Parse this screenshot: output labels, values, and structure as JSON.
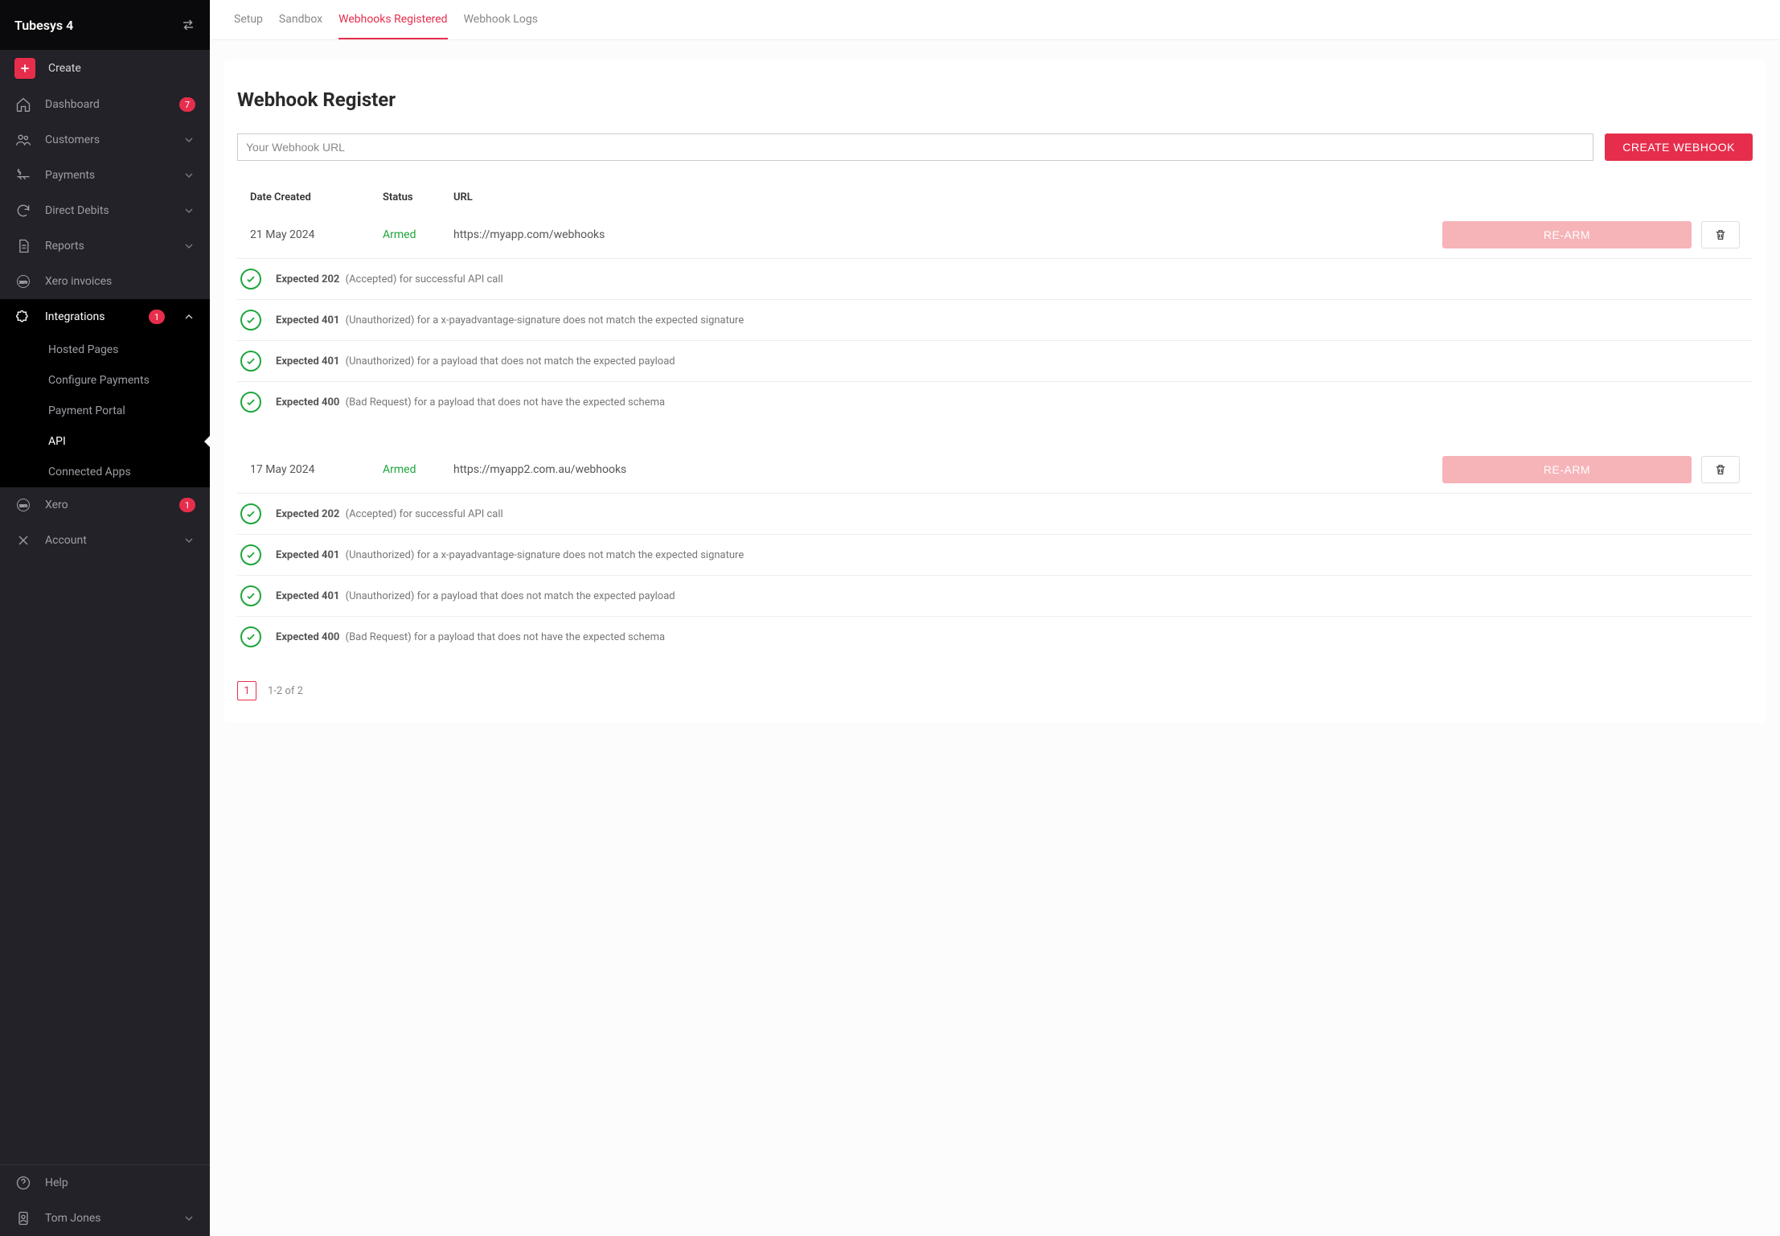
{
  "org": {
    "name": "Tubesys 4"
  },
  "sidebar": {
    "create_label": "Create",
    "items": {
      "dashboard": {
        "label": "Dashboard",
        "badge": "7"
      },
      "customers": {
        "label": "Customers"
      },
      "payments": {
        "label": "Payments"
      },
      "directdebits": {
        "label": "Direct Debits"
      },
      "reports": {
        "label": "Reports"
      },
      "xeroinv": {
        "label": "Xero invoices"
      },
      "integrations": {
        "label": "Integrations",
        "badge": "1"
      },
      "xero": {
        "label": "Xero",
        "badge": "1"
      },
      "account": {
        "label": "Account"
      },
      "help": {
        "label": "Help"
      },
      "user": {
        "label": "Tom Jones"
      }
    },
    "sub": {
      "hosted": "Hosted Pages",
      "config": "Configure Payments",
      "portal": "Payment Portal",
      "api": "API",
      "apps": "Connected Apps"
    }
  },
  "tabs": {
    "setup": "Setup",
    "sandbox": "Sandbox",
    "registered": "Webhooks Registered",
    "logs": "Webhook Logs"
  },
  "page": {
    "title": "Webhook Register",
    "url_placeholder": "Your Webhook URL",
    "create_btn": "CREATE WEBHOOK",
    "rearm_btn": "RE-ARM",
    "cols": {
      "date": "Date Created",
      "status": "Status",
      "url": "URL"
    }
  },
  "checks": [
    {
      "bold": "Expected 202",
      "rest": " (Accepted) for successful API call"
    },
    {
      "bold": "Expected 401",
      "rest": " (Unauthorized) for a x-payadvantage-signature does not match the expected signature"
    },
    {
      "bold": "Expected 401",
      "rest": " (Unauthorized) for a payload that does not match the expected payload"
    },
    {
      "bold": "Expected 400",
      "rest": " (Bad Request) for a payload that does not have the expected schema"
    }
  ],
  "webhooks": [
    {
      "date": "21 May 2024",
      "status": "Armed",
      "url": "https://myapp.com/webhooks"
    },
    {
      "date": "17 May 2024",
      "status": "Armed",
      "url": "https://myapp2.com.au/webhooks"
    }
  ],
  "pagination": {
    "page": "1",
    "range": "1-2 of 2"
  }
}
